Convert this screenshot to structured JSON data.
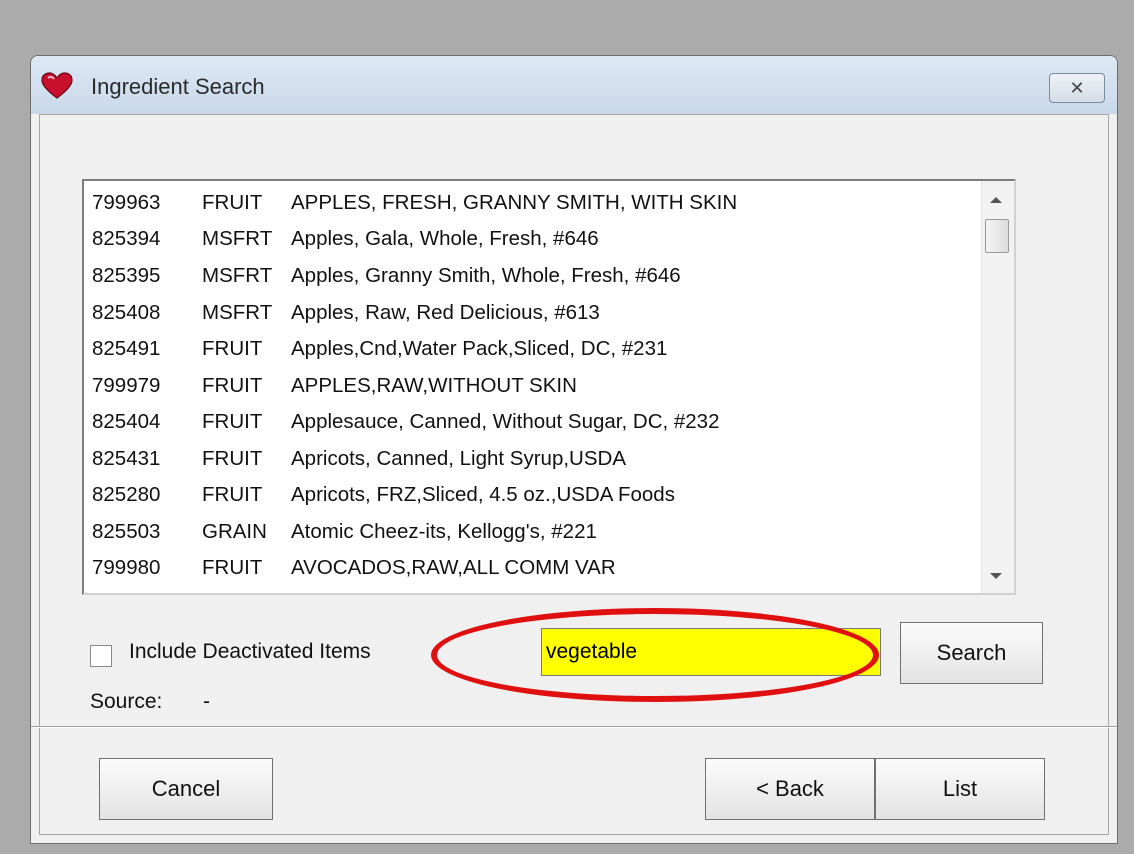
{
  "window": {
    "title": "Ingredient Search",
    "close_symbol": "✕"
  },
  "list": {
    "rows": [
      {
        "id": "799963",
        "group": "FRUIT",
        "desc": "APPLES, FRESH, GRANNY SMITH, WITH SKIN"
      },
      {
        "id": "825394",
        "group": "MSFRT",
        "desc": "Apples, Gala, Whole, Fresh, #646"
      },
      {
        "id": "825395",
        "group": "MSFRT",
        "desc": "Apples, Granny Smith, Whole, Fresh, #646"
      },
      {
        "id": "825408",
        "group": "MSFRT",
        "desc": "Apples, Raw, Red Delicious, #613"
      },
      {
        "id": "825491",
        "group": "FRUIT",
        "desc": "Apples,Cnd,Water Pack,Sliced, DC, #231"
      },
      {
        "id": "799979",
        "group": "FRUIT",
        "desc": "APPLES,RAW,WITHOUT SKIN"
      },
      {
        "id": "825404",
        "group": "FRUIT",
        "desc": "Applesauce, Canned, Without Sugar, DC, #232"
      },
      {
        "id": "825431",
        "group": "FRUIT",
        "desc": "Apricots, Canned, Light Syrup,USDA"
      },
      {
        "id": "825280",
        "group": "FRUIT",
        "desc": "Apricots, FRZ,Sliced, 4.5 oz.,USDA Foods"
      },
      {
        "id": "825503",
        "group": "GRAIN",
        "desc": "Atomic Cheez-its, Kellogg's, #221"
      },
      {
        "id": "799980",
        "group": "FRUIT",
        "desc": "AVOCADOS,RAW,ALL COMM VAR"
      }
    ]
  },
  "include_deactivated": {
    "label": "Include Deactivated Items",
    "checked": false
  },
  "search": {
    "value": "vegetable",
    "button_label": "Search",
    "highlight_color": "#ffff00",
    "callout_color": "#e01010"
  },
  "source": {
    "label": "Source:",
    "value": "-"
  },
  "footer": {
    "cancel_label": "Cancel",
    "back_label": "< Back",
    "list_label": "List"
  },
  "icons": {
    "app": "heart-icon",
    "close": "close-icon",
    "scroll_up": "scroll-up-icon",
    "scroll_down": "scroll-down-icon"
  }
}
